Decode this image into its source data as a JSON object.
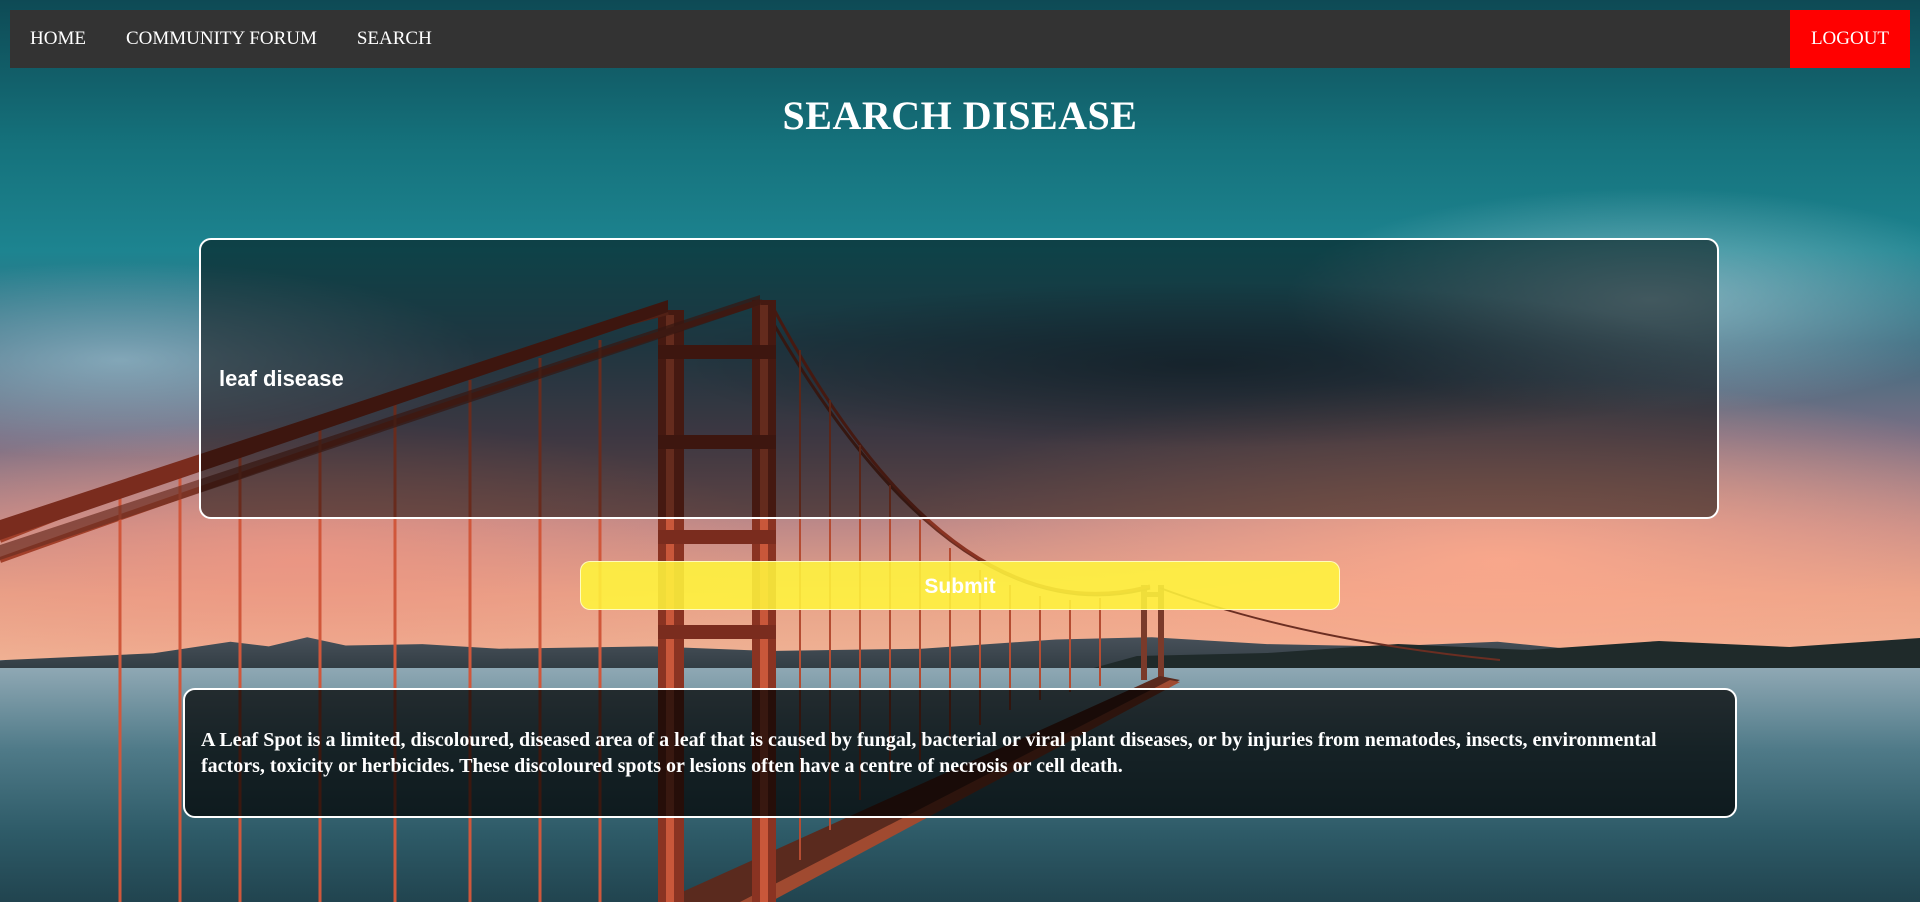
{
  "nav": {
    "items": [
      {
        "label": "HOME"
      },
      {
        "label": "COMMUNITY FORUM"
      },
      {
        "label": "SEARCH"
      }
    ],
    "logout_label": "LOGOUT",
    "logout_color": "#ff0000",
    "bar_color": "#333333"
  },
  "main": {
    "title": "SEARCH DISEASE",
    "search_value": "leaf disease",
    "submit_label": "Submit",
    "submit_color": "#fff53c",
    "result_text": "A Leaf Spot is a limited, discoloured, diseased area of a leaf that is caused by fungal, bacterial or viral plant diseases, or by injuries from nematodes, insects, environmental factors, toxicity or herbicides. These discoloured spots or lesions often have a centre of necrosis or cell death."
  }
}
